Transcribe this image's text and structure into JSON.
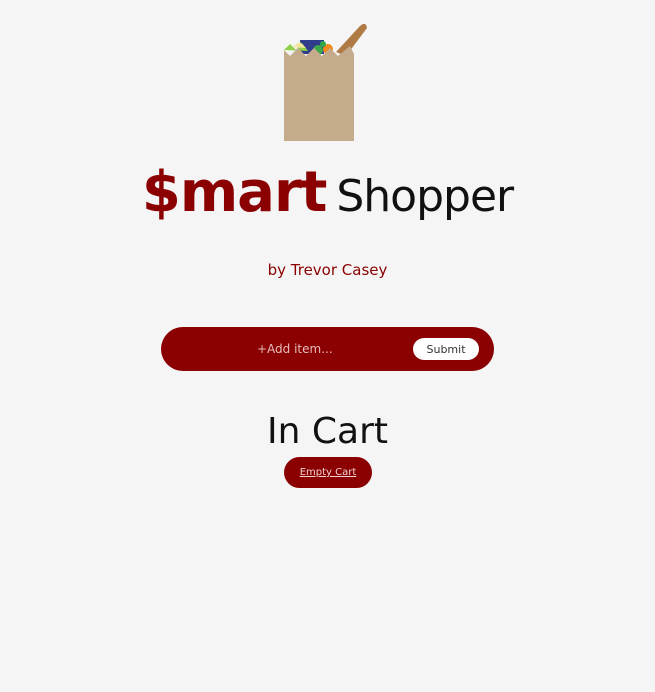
{
  "header": {
    "logo_icon": "grocery-bag-icon",
    "title_bold": "$mart",
    "title_light": "Shopper",
    "byline": "by Trevor Casey"
  },
  "add_form": {
    "placeholder": "+Add item...",
    "value": "",
    "submit_label": "Submit"
  },
  "cart": {
    "heading": "In Cart",
    "empty_label": "Empty Cart",
    "items": []
  },
  "colors": {
    "accent": "#8b0000",
    "background": "#f5f5f5",
    "bag": "#c4ab8c"
  }
}
